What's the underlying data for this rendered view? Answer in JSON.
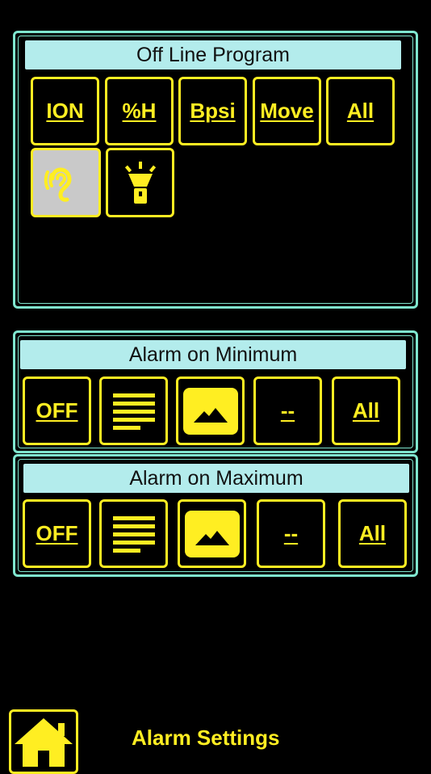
{
  "colors": {
    "background": "#000000",
    "panel_border": "#7fe6cf",
    "title_bar": "#b3ecec",
    "accent_yellow": "#ffee22",
    "selected_gray": "#c9c9c9"
  },
  "offline_program": {
    "title": "Off Line Program",
    "buttons": [
      {
        "label": "ION"
      },
      {
        "label": "%H"
      },
      {
        "label": "Bpsi"
      },
      {
        "label": "Move"
      },
      {
        "label": "All"
      }
    ],
    "icon_buttons": [
      {
        "icon": "ear-icon",
        "selected": true
      },
      {
        "icon": "flashlight-icon",
        "selected": false
      }
    ]
  },
  "alarm_min": {
    "title": "Alarm on Minimum",
    "off_label": "OFF",
    "list_icon": "list-lines-icon",
    "image_icon": "mountain-image-icon",
    "dash_label": "--",
    "all_label": "All"
  },
  "alarm_max": {
    "title": "Alarm on Maximum",
    "off_label": "OFF",
    "list_icon": "list-lines-icon",
    "image_icon": "mountain-image-icon",
    "dash_label": "--",
    "all_label": "All"
  },
  "footer": {
    "home_icon": "home-icon",
    "screen_title": "Alarm Settings"
  }
}
